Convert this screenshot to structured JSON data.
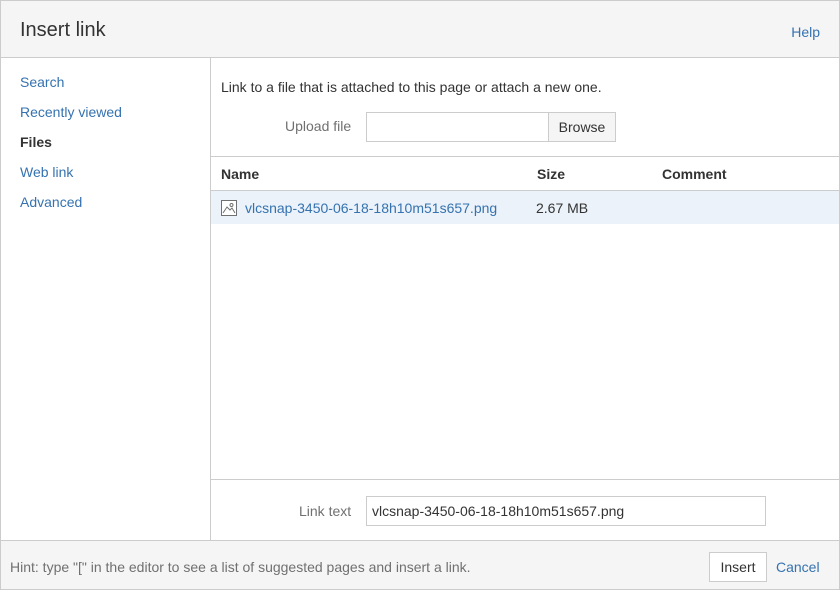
{
  "header": {
    "title": "Insert link",
    "help_label": "Help"
  },
  "sidebar": {
    "items": [
      {
        "label": "Search"
      },
      {
        "label": "Recently viewed"
      },
      {
        "label": "Files"
      },
      {
        "label": "Web link"
      },
      {
        "label": "Advanced"
      }
    ]
  },
  "main": {
    "intro": "Link to a file that is attached to this page or attach a new one.",
    "upload_label": "Upload file",
    "browse_label": "Browse",
    "table": {
      "headers": [
        "Name",
        "Size",
        "Comment"
      ],
      "rows": [
        {
          "icon": "image-file-icon",
          "name": "vlcsnap-3450-06-18-18h10m51s657.png",
          "size": "2.67 MB",
          "comment": ""
        }
      ]
    },
    "link_text_label": "Link text",
    "link_text_value": "vlcsnap-3450-06-18-18h10m51s657.png"
  },
  "footer": {
    "hint": "Hint: type \"[\" in the editor to see a list of suggested pages and insert a link.",
    "insert_label": "Insert",
    "cancel_label": "Cancel"
  },
  "colors": {
    "link": "#3572b0",
    "selected_row": "#ebf2f9",
    "panel": "#f5f5f5"
  }
}
